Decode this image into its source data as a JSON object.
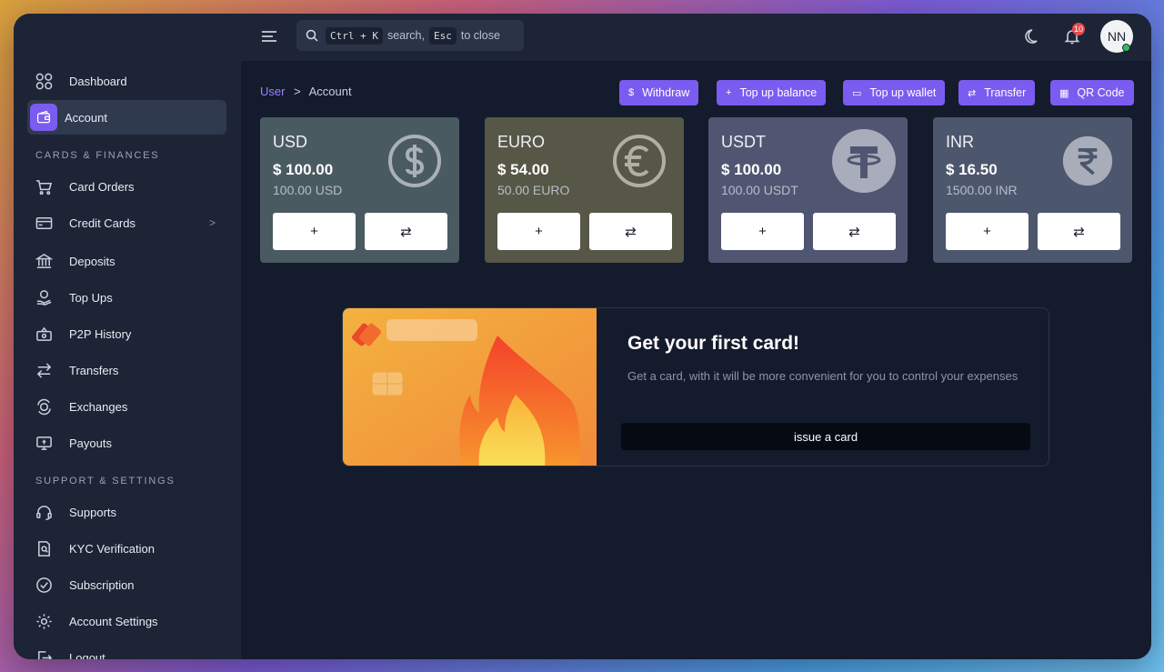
{
  "topbar": {
    "search_hint_kbd1": "Ctrl + K",
    "search_hint_text1": "search,",
    "search_hint_kbd2": "Esc",
    "search_hint_text2": "to close",
    "notification_count": "10",
    "avatar_initials": "NN"
  },
  "sidebar": {
    "top_items": [
      {
        "label": "Dashboard",
        "icon": "grid-icon"
      },
      {
        "label": "Account",
        "icon": "wallet-icon",
        "active": true
      }
    ],
    "section1": "CARDS & FINANCES",
    "cards_items": [
      {
        "label": "Card Orders",
        "icon": "cart-icon"
      },
      {
        "label": "Credit Cards",
        "icon": "credit-card-icon",
        "chevron": ">"
      },
      {
        "label": "Deposits",
        "icon": "bank-icon"
      },
      {
        "label": "Top Ups",
        "icon": "hand-coin-icon"
      },
      {
        "label": "P2P History",
        "icon": "p2p-icon"
      },
      {
        "label": "Transfers",
        "icon": "transfer-icon"
      },
      {
        "label": "Exchanges",
        "icon": "exchange-icon"
      },
      {
        "label": "Payouts",
        "icon": "payout-icon"
      }
    ],
    "section2": "SUPPORT & SETTINGS",
    "support_items": [
      {
        "label": "Supports",
        "icon": "headset-icon"
      },
      {
        "label": "KYC Verification",
        "icon": "id-document-icon"
      },
      {
        "label": "Subscription",
        "icon": "subscription-icon"
      },
      {
        "label": "Account Settings",
        "icon": "gear-icon"
      },
      {
        "label": "Logout",
        "icon": "logout-icon"
      }
    ]
  },
  "breadcrumb": {
    "parent": "User",
    "separator": ">",
    "current": "Account"
  },
  "actions": [
    {
      "label": "Withdraw",
      "icon": "$"
    },
    {
      "label": "Top up balance",
      "icon": "+"
    },
    {
      "label": "Top up wallet",
      "icon": "▭"
    },
    {
      "label": "Transfer",
      "icon": "⇄"
    },
    {
      "label": "QR Code",
      "icon": "▦"
    }
  ],
  "wallets": [
    {
      "currency": "USD",
      "amount": "$ 100.00",
      "sub": "100.00 USD",
      "color": "#4a5a61",
      "symbol": "dollar-circle-icon"
    },
    {
      "currency": "EURO",
      "amount": "$ 54.00",
      "sub": "50.00 EURO",
      "color": "#565746",
      "symbol": "euro-circle-icon"
    },
    {
      "currency": "USDT",
      "amount": "$ 100.00",
      "sub": "100.00 USDT",
      "color": "#505672",
      "symbol": "tether-icon"
    },
    {
      "currency": "INR",
      "amount": "$ 16.50",
      "sub": "1500.00 INR",
      "color": "#4c566d",
      "symbol": "rupee-circle-icon"
    }
  ],
  "wallet_buttons": {
    "add": "+",
    "exchange": "⇄"
  },
  "promo": {
    "title": "Get your first card!",
    "desc": "Get a card, with it will be more convenient for you to control your expenses",
    "button": "issue a card"
  }
}
